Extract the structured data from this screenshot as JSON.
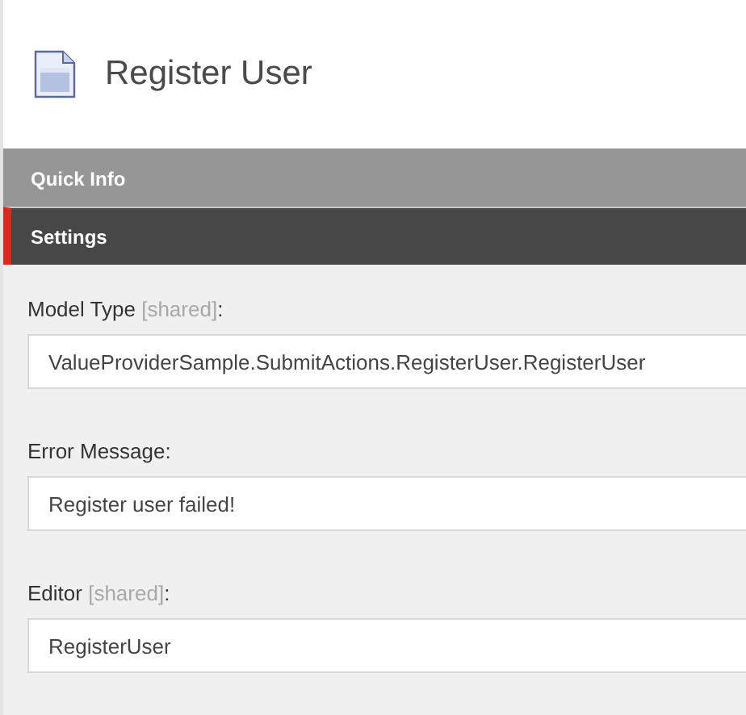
{
  "header": {
    "title": "Register User"
  },
  "sections": [
    {
      "label": "Quick Info",
      "selected": false
    },
    {
      "label": "Settings",
      "selected": true
    }
  ],
  "fields": [
    {
      "label": "Model Type",
      "note": "[shared]",
      "label_end": ":",
      "value": "ValueProviderSample.SubmitActions.RegisterUser.RegisterUser"
    },
    {
      "label": "Error Message:",
      "value": "Register user failed!"
    },
    {
      "label": "Editor",
      "note": "[shared]",
      "label_end": ":",
      "value": "RegisterUser"
    }
  ]
}
